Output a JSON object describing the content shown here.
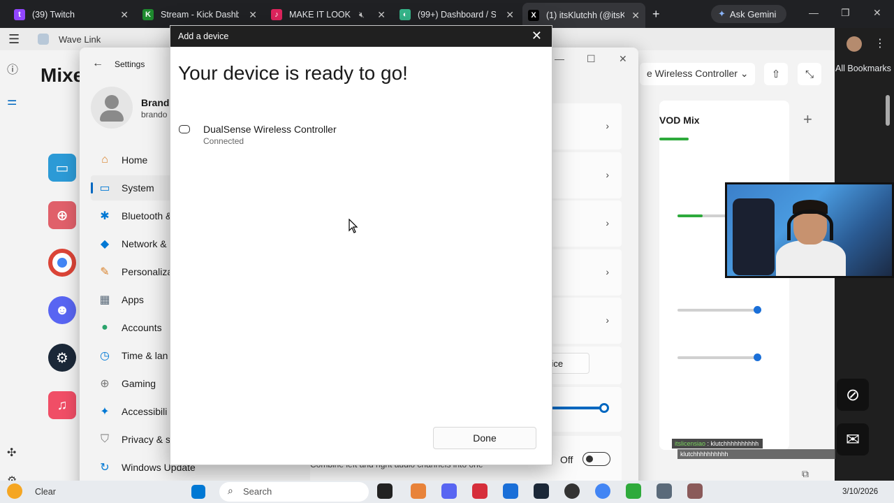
{
  "browser": {
    "tabs": [
      {
        "label": "(39) Twitch",
        "color": "#9146ff",
        "glyph": "t"
      },
      {
        "label": "Stream - Kick Dashbo",
        "color": "#1e8a2e",
        "glyph": "K"
      },
      {
        "label": "MAKE IT LOOK PL",
        "color": "#e0245e",
        "glyph": "♪"
      },
      {
        "label": "(99+) Dashboard / St",
        "color": "#35b58a",
        "glyph": "◐"
      },
      {
        "label": "(1) itsKlutchh (@itsKl",
        "color": "#000000",
        "glyph": "X"
      }
    ],
    "new_tab": "+",
    "gemini_label": "Ask Gemini",
    "bookmarks_label": "All Bookmarks"
  },
  "wavelink": {
    "title": "Wave Link",
    "heading": "Mixe",
    "output_device": "e Wireless Controller",
    "mix_label": "VOD Mix"
  },
  "settings": {
    "title": "Settings",
    "user_name": "Brando",
    "user_email": "brando",
    "nav": [
      {
        "label": "Home",
        "icon": "home-icon",
        "glyph": "⌂",
        "color": "#d9822b"
      },
      {
        "label": "System",
        "icon": "system-icon",
        "glyph": "▭",
        "color": "#0078d4",
        "selected": true
      },
      {
        "label": "Bluetooth &",
        "icon": "bluetooth-icon",
        "glyph": "✱",
        "color": "#0078d4"
      },
      {
        "label": "Network &",
        "icon": "wifi-icon",
        "glyph": "◆",
        "color": "#0078d4"
      },
      {
        "label": "Personaliza",
        "icon": "brush-icon",
        "glyph": "✎",
        "color": "#d9822b"
      },
      {
        "label": "Apps",
        "icon": "apps-icon",
        "glyph": "▦",
        "color": "#5a6a7a"
      },
      {
        "label": "Accounts",
        "icon": "accounts-icon",
        "glyph": "●",
        "color": "#2aa36b"
      },
      {
        "label": "Time & lan",
        "icon": "clock-icon",
        "glyph": "◷",
        "color": "#0078d4"
      },
      {
        "label": "Gaming",
        "icon": "gamepad-icon",
        "glyph": "⊕",
        "color": "#777777"
      },
      {
        "label": "Accessibili",
        "icon": "accessibility-icon",
        "glyph": "✦",
        "color": "#0078d4"
      },
      {
        "label": "Privacy & s",
        "icon": "shield-icon",
        "glyph": "⛉",
        "color": "#777777"
      },
      {
        "label": "Windows Update",
        "icon": "update-icon",
        "glyph": "↻",
        "color": "#0078d4"
      }
    ],
    "add_device_btn": "vice",
    "toggle_state": "Off",
    "mono_text": "Combine left and right audio channels into one"
  },
  "dialog": {
    "title": "Add a device",
    "heading": "Your device is ready to go!",
    "device_name": "DualSense Wireless Controller",
    "device_status": "Connected",
    "done_label": "Done"
  },
  "overlay": {
    "chat_user": "itslicensiao",
    "chat_msg1": ": klutchhhhhhhhhh",
    "chat_msg2": "klutchhhhhhhhhh"
  },
  "taskbar": {
    "weather": "Clear",
    "search_placeholder": "Search",
    "date": "3/10/2026"
  }
}
